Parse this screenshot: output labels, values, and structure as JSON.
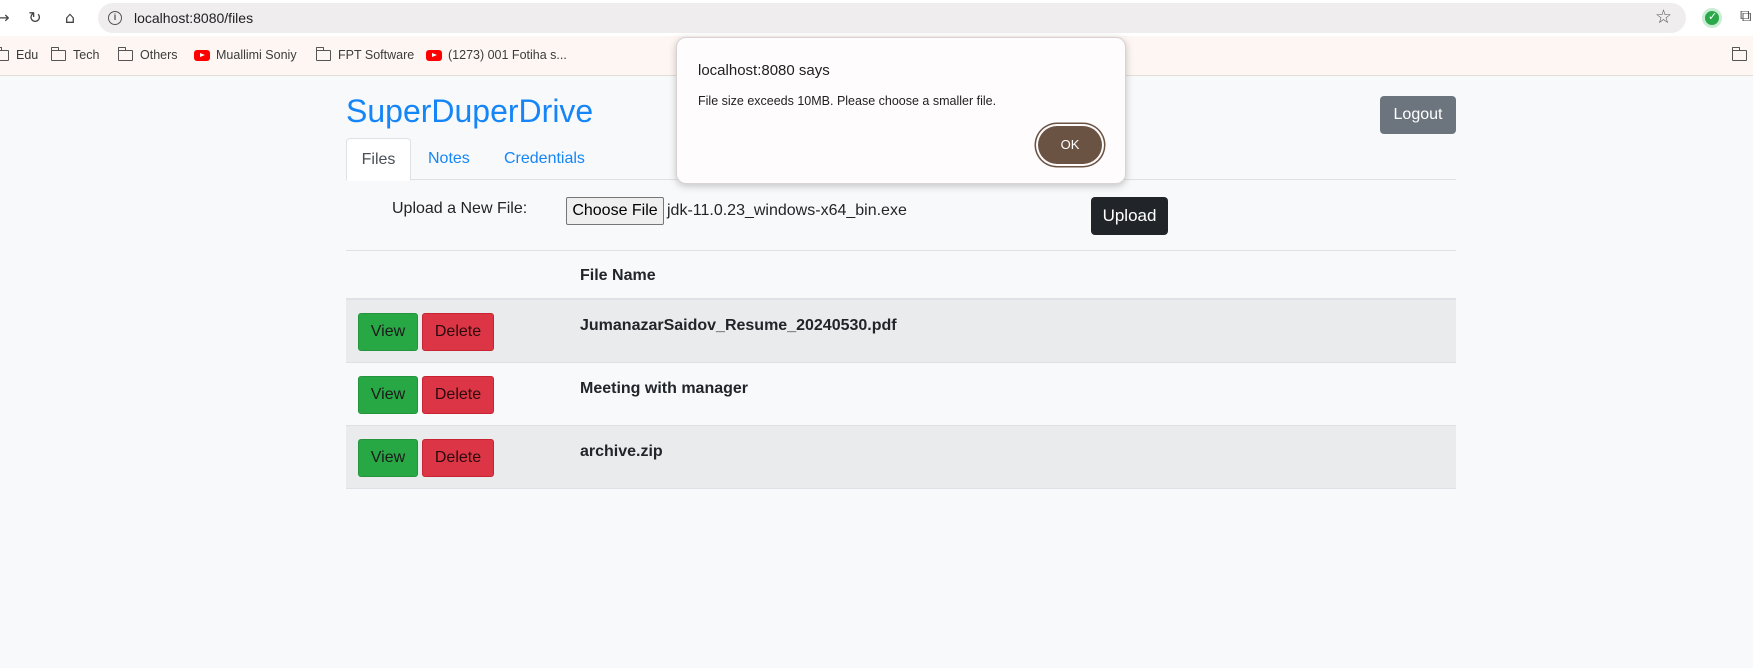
{
  "browser": {
    "url": "localhost:8080/files",
    "icons": [
      "back-arrow-icon",
      "reload-icon",
      "home-icon",
      "site-info-icon",
      "bookmark-star-icon",
      "extension-shield-icon",
      "extensions-puzzle-icon"
    ],
    "bookmarks": [
      {
        "label": "Edu",
        "icon": "folder-icon"
      },
      {
        "label": "Tech",
        "icon": "folder-icon"
      },
      {
        "label": "Others",
        "icon": "folder-icon"
      },
      {
        "label": "Muallimi Soniy",
        "icon": "youtube-icon"
      },
      {
        "label": "FPT Software",
        "icon": "folder-icon"
      },
      {
        "label": "(1273) 001 Fotiha s...",
        "icon": "youtube-icon"
      }
    ]
  },
  "app": {
    "brand": "SuperDuperDrive",
    "logout_label": "Logout",
    "tabs": [
      {
        "label": "Files",
        "active": true
      },
      {
        "label": "Notes",
        "active": false
      },
      {
        "label": "Credentials",
        "active": false
      }
    ],
    "upload": {
      "label": "Upload a New File:",
      "choose_label": "Choose File",
      "chosen_file": "jdk-11.0.23_windows-x64_bin.exe",
      "button_label": "Upload"
    },
    "table": {
      "header_name": "File Name",
      "view_label": "View",
      "delete_label": "Delete",
      "rows": [
        {
          "name": "JumanazarSaidov_Resume_20240530.pdf"
        },
        {
          "name": "Meeting with manager"
        },
        {
          "name": "archive.zip"
        }
      ]
    }
  },
  "dialog": {
    "title": "localhost:8080 says",
    "message": "File size exceeds 10MB. Please choose a smaller file.",
    "ok_label": "OK"
  },
  "colors": {
    "brand": "#1585f7",
    "view": "#28a745",
    "delete": "#dc3545",
    "upload": "#212529",
    "logout": "#6c757d",
    "dialog_ok": "#6b5344"
  }
}
